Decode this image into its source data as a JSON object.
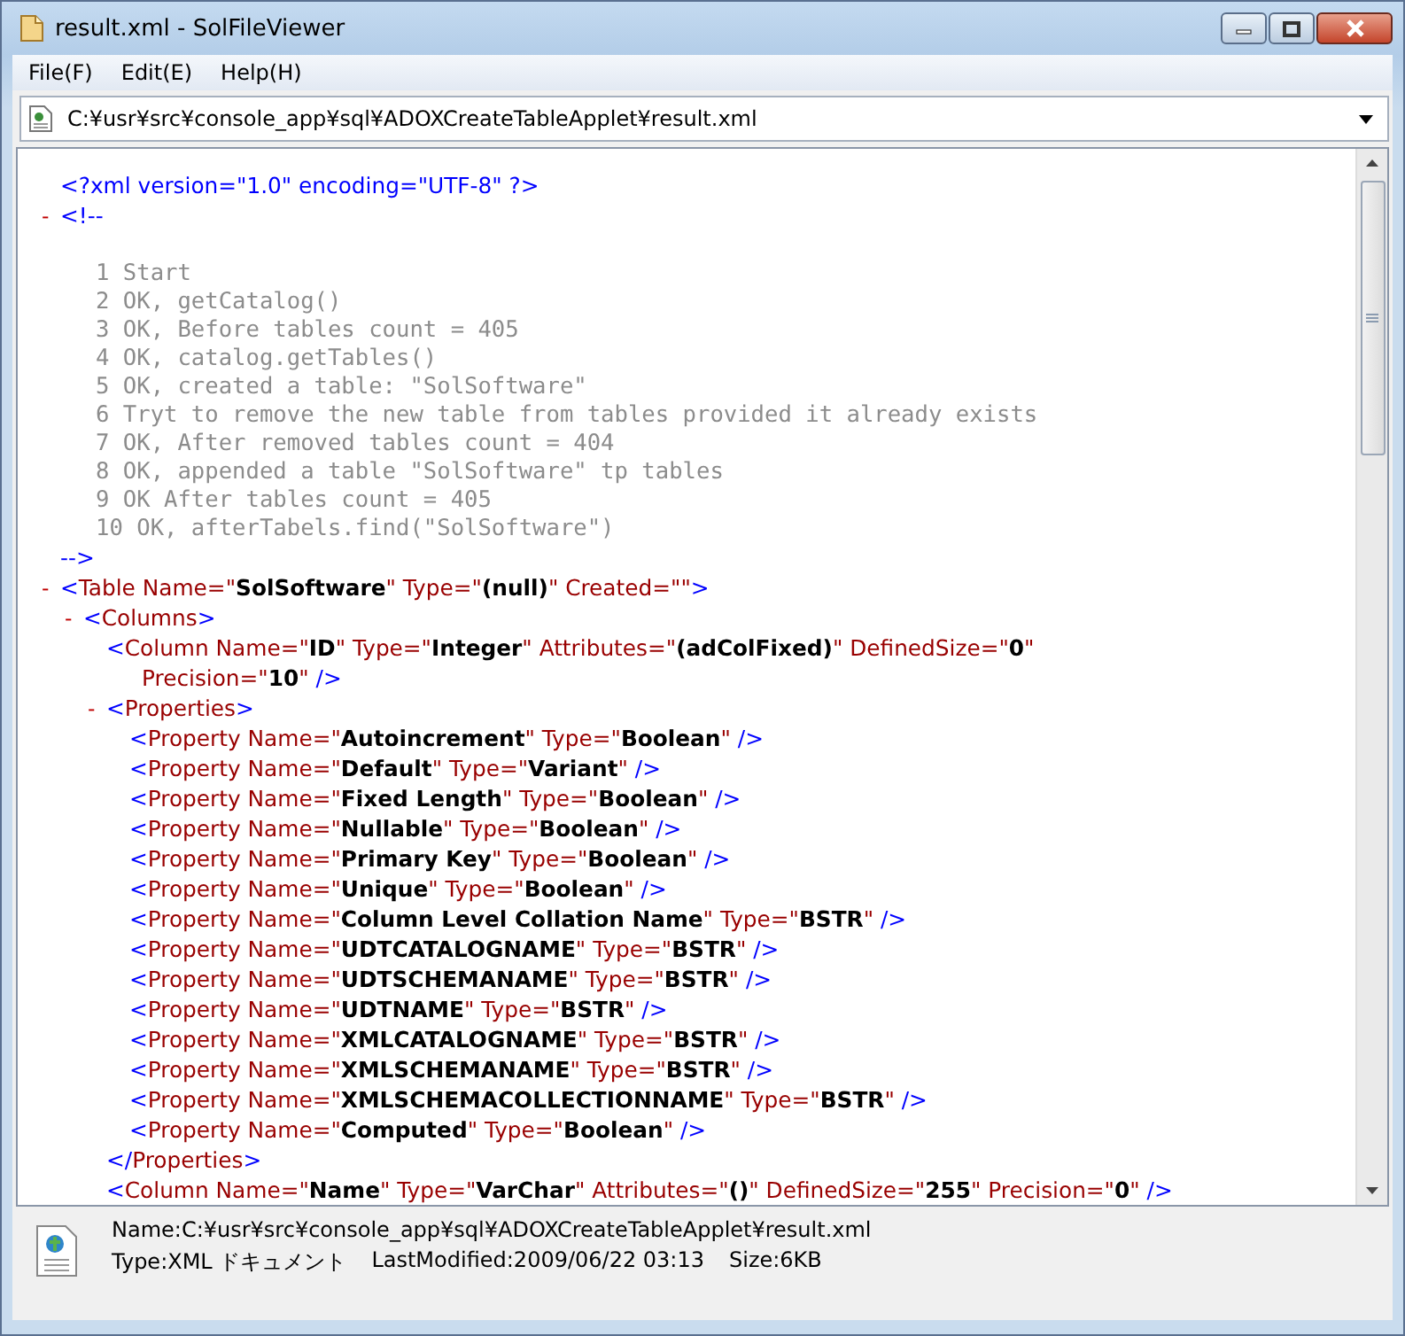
{
  "window": {
    "title": "result.xml - SolFileViewer"
  },
  "menu": [
    "File(F)",
    "Edit(E)",
    "Help(H)"
  ],
  "address": {
    "value": "C:¥usr¥src¥console_app¥sql¥ADOXCreateTableApplet¥result.xml"
  },
  "document": [
    {
      "kind": "pi",
      "text": "<?xml version=\"1.0\" encoding=\"UTF-8\" ?>"
    },
    {
      "kind": "comment",
      "toggle": "-",
      "expanded": true,
      "open": "<!--",
      "close": "-->",
      "lines": [
        "1 Start",
        "2 OK, getCatalog()",
        "3 OK, Before tables count = 405",
        "4 OK, catalog.getTables()",
        "5 OK, created a table: \"SolSoftware\"",
        "6 Tryt to remove the new table from tables provided it already exists",
        "7 OK, After removed tables count = 404",
        "8 OK, appended a table \"SolSoftware\" tp tables",
        "9 OK After tables count = 405",
        "10 OK, afterTabels.find(\"SolSoftware\")"
      ]
    },
    {
      "kind": "element",
      "toggle": "-",
      "expanded": true,
      "tokens": [
        {
          "kind": "mark",
          "t": "<"
        },
        {
          "kind": "tag",
          "t": "Table"
        },
        {
          "kind": "attr",
          "t": " Name=\"**SolSoftware**\""
        },
        {
          "kind": "attr",
          "t": " Type=\"**(null)**\""
        },
        {
          "kind": "attr",
          "t": " Created=\"\""
        },
        {
          "kind": "mark",
          "t": ">"
        }
      ],
      "children": [
        {
          "kind": "element",
          "toggle": "-",
          "expanded": true,
          "tokens": [
            {
              "kind": "mark",
              "t": "<"
            },
            {
              "kind": "tag",
              "t": "Columns"
            },
            {
              "kind": "mark",
              "t": ">"
            }
          ],
          "children": [
            {
              "kind": "element",
              "tokens": [
                {
                  "kind": "mark",
                  "t": "<"
                },
                {
                  "kind": "tag",
                  "t": "Column"
                },
                {
                  "kind": "attr",
                  "t": " Name=\"**ID**\""
                },
                {
                  "kind": "attr",
                  "t": " Type=\"**Integer**\""
                },
                {
                  "kind": "attr",
                  "t": " Attributes=\"**(adColFixed)**\""
                },
                {
                  "kind": "attr",
                  "t": " DefinedSize=\"**0**\""
                }
              ],
              "wrap": [
                {
                  "kind": "attr",
                  "t": "Precision=\"**10**\""
                },
                {
                  "kind": "mark",
                  "t": " />"
                }
              ]
            },
            {
              "kind": "element",
              "toggle": "-",
              "expanded": true,
              "tokens": [
                {
                  "kind": "mark",
                  "t": "<"
                },
                {
                  "kind": "tag",
                  "t": "Properties"
                },
                {
                  "kind": "mark",
                  "t": ">"
                }
              ],
              "closing": [
                {
                  "kind": "mark",
                  "t": "</"
                },
                {
                  "kind": "tag",
                  "t": "Properties"
                },
                {
                  "kind": "mark",
                  "t": ">"
                }
              ],
              "children": [
                {
                  "kind": "element",
                  "tokens": [
                    {
                      "kind": "mark",
                      "t": "<"
                    },
                    {
                      "kind": "tag",
                      "t": "Property"
                    },
                    {
                      "kind": "attr",
                      "t": " Name=\"**Autoincrement**\""
                    },
                    {
                      "kind": "attr",
                      "t": " Type=\"**Boolean**\""
                    },
                    {
                      "kind": "mark",
                      "t": " />"
                    }
                  ]
                },
                {
                  "kind": "element",
                  "tokens": [
                    {
                      "kind": "mark",
                      "t": "<"
                    },
                    {
                      "kind": "tag",
                      "t": "Property"
                    },
                    {
                      "kind": "attr",
                      "t": " Name=\"**Default**\""
                    },
                    {
                      "kind": "attr",
                      "t": " Type=\"**Variant**\""
                    },
                    {
                      "kind": "mark",
                      "t": " />"
                    }
                  ]
                },
                {
                  "kind": "element",
                  "tokens": [
                    {
                      "kind": "mark",
                      "t": "<"
                    },
                    {
                      "kind": "tag",
                      "t": "Property"
                    },
                    {
                      "kind": "attr",
                      "t": " Name=\"**Fixed Length**\""
                    },
                    {
                      "kind": "attr",
                      "t": " Type=\"**Boolean**\""
                    },
                    {
                      "kind": "mark",
                      "t": " />"
                    }
                  ]
                },
                {
                  "kind": "element",
                  "tokens": [
                    {
                      "kind": "mark",
                      "t": "<"
                    },
                    {
                      "kind": "tag",
                      "t": "Property"
                    },
                    {
                      "kind": "attr",
                      "t": " Name=\"**Nullable**\""
                    },
                    {
                      "kind": "attr",
                      "t": " Type=\"**Boolean**\""
                    },
                    {
                      "kind": "mark",
                      "t": " />"
                    }
                  ]
                },
                {
                  "kind": "element",
                  "tokens": [
                    {
                      "kind": "mark",
                      "t": "<"
                    },
                    {
                      "kind": "tag",
                      "t": "Property"
                    },
                    {
                      "kind": "attr",
                      "t": " Name=\"**Primary Key**\""
                    },
                    {
                      "kind": "attr",
                      "t": " Type=\"**Boolean**\""
                    },
                    {
                      "kind": "mark",
                      "t": " />"
                    }
                  ]
                },
                {
                  "kind": "element",
                  "tokens": [
                    {
                      "kind": "mark",
                      "t": "<"
                    },
                    {
                      "kind": "tag",
                      "t": "Property"
                    },
                    {
                      "kind": "attr",
                      "t": " Name=\"**Unique**\""
                    },
                    {
                      "kind": "attr",
                      "t": " Type=\"**Boolean**\""
                    },
                    {
                      "kind": "mark",
                      "t": " />"
                    }
                  ]
                },
                {
                  "kind": "element",
                  "tokens": [
                    {
                      "kind": "mark",
                      "t": "<"
                    },
                    {
                      "kind": "tag",
                      "t": "Property"
                    },
                    {
                      "kind": "attr",
                      "t": " Name=\"**Column Level Collation Name**\""
                    },
                    {
                      "kind": "attr",
                      "t": " Type=\"**BSTR**\""
                    },
                    {
                      "kind": "mark",
                      "t": " />"
                    }
                  ]
                },
                {
                  "kind": "element",
                  "tokens": [
                    {
                      "kind": "mark",
                      "t": "<"
                    },
                    {
                      "kind": "tag",
                      "t": "Property"
                    },
                    {
                      "kind": "attr",
                      "t": " Name=\"**UDTCATALOGNAME**\""
                    },
                    {
                      "kind": "attr",
                      "t": " Type=\"**BSTR**\""
                    },
                    {
                      "kind": "mark",
                      "t": " />"
                    }
                  ]
                },
                {
                  "kind": "element",
                  "tokens": [
                    {
                      "kind": "mark",
                      "t": "<"
                    },
                    {
                      "kind": "tag",
                      "t": "Property"
                    },
                    {
                      "kind": "attr",
                      "t": " Name=\"**UDTSCHEMANAME**\""
                    },
                    {
                      "kind": "attr",
                      "t": " Type=\"**BSTR**\""
                    },
                    {
                      "kind": "mark",
                      "t": " />"
                    }
                  ]
                },
                {
                  "kind": "element",
                  "tokens": [
                    {
                      "kind": "mark",
                      "t": "<"
                    },
                    {
                      "kind": "tag",
                      "t": "Property"
                    },
                    {
                      "kind": "attr",
                      "t": " Name=\"**UDTNAME**\""
                    },
                    {
                      "kind": "attr",
                      "t": " Type=\"**BSTR**\""
                    },
                    {
                      "kind": "mark",
                      "t": " />"
                    }
                  ]
                },
                {
                  "kind": "element",
                  "tokens": [
                    {
                      "kind": "mark",
                      "t": "<"
                    },
                    {
                      "kind": "tag",
                      "t": "Property"
                    },
                    {
                      "kind": "attr",
                      "t": " Name=\"**XMLCATALOGNAME**\""
                    },
                    {
                      "kind": "attr",
                      "t": " Type=\"**BSTR**\""
                    },
                    {
                      "kind": "mark",
                      "t": " />"
                    }
                  ]
                },
                {
                  "kind": "element",
                  "tokens": [
                    {
                      "kind": "mark",
                      "t": "<"
                    },
                    {
                      "kind": "tag",
                      "t": "Property"
                    },
                    {
                      "kind": "attr",
                      "t": " Name=\"**XMLSCHEMANAME**\""
                    },
                    {
                      "kind": "attr",
                      "t": " Type=\"**BSTR**\""
                    },
                    {
                      "kind": "mark",
                      "t": " />"
                    }
                  ]
                },
                {
                  "kind": "element",
                  "tokens": [
                    {
                      "kind": "mark",
                      "t": "<"
                    },
                    {
                      "kind": "tag",
                      "t": "Property"
                    },
                    {
                      "kind": "attr",
                      "t": " Name=\"**XMLSCHEMACOLLECTIONNAME**\""
                    },
                    {
                      "kind": "attr",
                      "t": " Type=\"**BSTR**\""
                    },
                    {
                      "kind": "mark",
                      "t": " />"
                    }
                  ]
                },
                {
                  "kind": "element",
                  "tokens": [
                    {
                      "kind": "mark",
                      "t": "<"
                    },
                    {
                      "kind": "tag",
                      "t": "Property"
                    },
                    {
                      "kind": "attr",
                      "t": " Name=\"**Computed**\""
                    },
                    {
                      "kind": "attr",
                      "t": " Type=\"**Boolean**\""
                    },
                    {
                      "kind": "mark",
                      "t": " />"
                    }
                  ]
                }
              ]
            },
            {
              "kind": "element",
              "tokens": [
                {
                  "kind": "mark",
                  "t": "<"
                },
                {
                  "kind": "tag",
                  "t": "Column"
                },
                {
                  "kind": "attr",
                  "t": " Name=\"**Name**\""
                },
                {
                  "kind": "attr",
                  "t": " Type=\"**VarChar**\""
                },
                {
                  "kind": "attr",
                  "t": " Attributes=\"**()**\""
                },
                {
                  "kind": "attr",
                  "t": " DefinedSize=\"**255**\""
                },
                {
                  "kind": "attr",
                  "t": " Precision=\"**0**\""
                },
                {
                  "kind": "mark",
                  "t": " />"
                }
              ]
            }
          ]
        }
      ]
    }
  ],
  "status": {
    "name": "Name:C:¥usr¥src¥console_app¥sql¥ADOXCreateTableApplet¥result.xml",
    "type": "Type:XML ドキュメント",
    "modified": "LastModified:2009/06/22 03:13",
    "size": "Size:6KB"
  }
}
